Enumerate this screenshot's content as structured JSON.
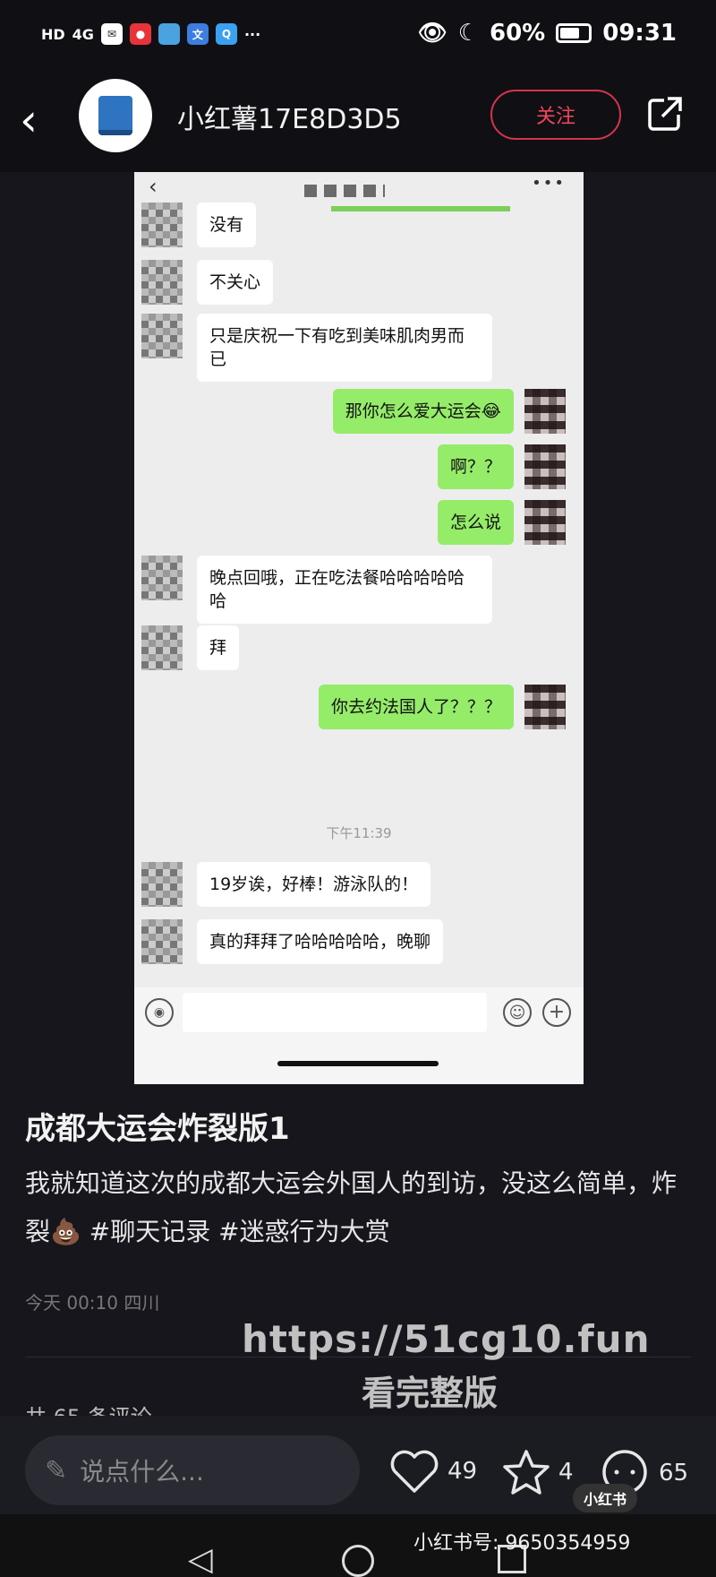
{
  "status_bar": {
    "network_label": "HD",
    "signal_label": "4G",
    "battery_percent": "60%",
    "time": "09:31"
  },
  "header": {
    "username": "小红薯17E8D3D5",
    "follow_label": "关注"
  },
  "chat": {
    "messages": [
      {
        "side": "in",
        "text": "没有"
      },
      {
        "side": "in",
        "text": "不关心"
      },
      {
        "side": "in",
        "text": "只是庆祝一下有吃到美味肌肉男而已"
      },
      {
        "side": "out",
        "text": "那你怎么爱大运会😂"
      },
      {
        "side": "out",
        "text": "啊？？"
      },
      {
        "side": "out",
        "text": "怎么说"
      },
      {
        "side": "in",
        "text": "晚点回哦，正在吃法餐哈哈哈哈哈哈"
      },
      {
        "side": "in",
        "text": "拜"
      },
      {
        "side": "out",
        "text": "你去约法国人了？？？"
      },
      {
        "side": "in",
        "text": "19岁诶，好棒！游泳队的！"
      },
      {
        "side": "in",
        "text": "真的拜拜了哈哈哈哈哈，晚聊"
      }
    ],
    "timestamp": "下午11:39"
  },
  "post": {
    "title": "成都大运会炸裂版1",
    "body": "我就知道这次的成都大运会外国人的到访，没这么简单，炸裂💩",
    "hashtags": [
      "#聊天记录",
      "#迷惑行为大赏"
    ],
    "meta": "今天 00:10 四川",
    "comment_count": "共 65 条评论"
  },
  "watermark": {
    "url": "https://51cg10.fun",
    "subtitle": "看完整版"
  },
  "bottom_bar": {
    "comment_placeholder": "说点什么...",
    "likes": "49",
    "stars": "4",
    "comments": "65"
  },
  "branding": {
    "badge": "小红书",
    "id_line": "小红书号: 9650354959"
  }
}
